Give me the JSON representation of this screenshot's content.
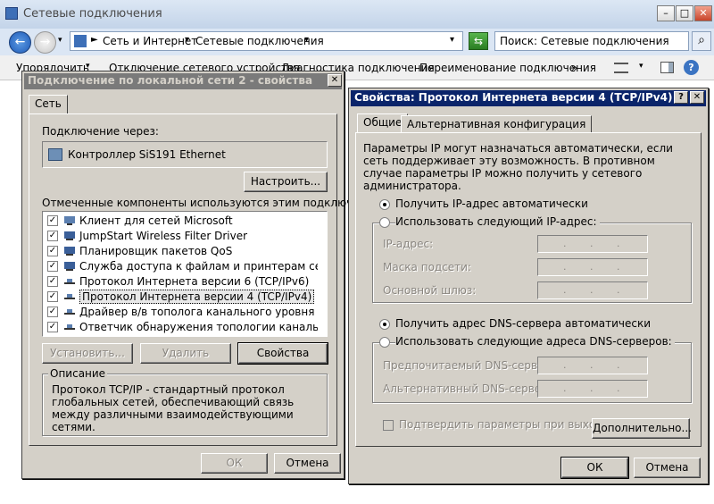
{
  "explorer": {
    "title": "Сетевые подключения",
    "breadcrumb": [
      "Сеть и Интернет",
      "Сетевые подключения"
    ],
    "search_placeholder": "Поиск: Сетевые подключения",
    "commands": [
      "Упорядочить",
      "Отключение сетевого устройства",
      "Диагностика подключения",
      "Переименование подключения",
      "»"
    ]
  },
  "left_dialog": {
    "title": "Подключение по локальной сети 2 - свойства",
    "tab": "Сеть",
    "connect_via_label": "Подключение через:",
    "adapter": "Контроллер SiS191 Ethernet",
    "configure_button": "Настроить...",
    "components_label": "Отмеченные компоненты используются этим подключением:",
    "components": [
      {
        "label": "Клиент для сетей Microsoft",
        "checked": true
      },
      {
        "label": "JumpStart Wireless Filter Driver",
        "checked": true
      },
      {
        "label": "Планировщик пакетов QoS",
        "checked": true
      },
      {
        "label": "Служба доступа к файлам и принтерам сетей Micro...",
        "checked": true
      },
      {
        "label": "Протокол Интернета версии 6 (TCP/IPv6)",
        "checked": true
      },
      {
        "label": "Протокол Интернета версии 4 (TCP/IPv4)",
        "checked": true
      },
      {
        "label": "Драйвер в/в тополога канального уровня",
        "checked": true
      },
      {
        "label": "Ответчик обнаружения топологии канального уровня",
        "checked": true
      }
    ],
    "install_button": "Установить...",
    "remove_button": "Удалить",
    "properties_button": "Свойства",
    "description_legend": "Описание",
    "description": "Протокол TCP/IP - стандартный протокол глобальных сетей, обеспечивающий связь между различными взаимодействующими сетями.",
    "ok_button": "ОК",
    "cancel_button": "Отмена"
  },
  "right_dialog": {
    "title": "Свойства: Протокол Интернета версии 4 (TCP/IPv4)",
    "help": "?",
    "tabs": [
      "Общие",
      "Альтернативная конфигурация"
    ],
    "intro": "Параметры IP могут назначаться автоматически, если сеть поддерживает эту возможность. В противном случае параметры IP можно получить у сетевого администратора.",
    "ip_auto": "Получить IP-адрес автоматически",
    "ip_manual": "Использовать следующий IP-адрес:",
    "ip_address_label": "IP-адрес:",
    "subnet_label": "Маска подсети:",
    "gateway_label": "Основной шлюз:",
    "dns_auto": "Получить адрес DNS-сервера автоматически",
    "dns_manual": "Использовать следующие адреса DNS-серверов:",
    "preferred_dns_label": "Предпочитаемый DNS-сервер:",
    "alternate_dns_label": "Альтернативный DNS-сервер:",
    "validate_label": "Подтвердить параметры при выходе",
    "advanced_button": "Дополнительно...",
    "ok_button": "ОК",
    "cancel_button": "Отмена"
  }
}
